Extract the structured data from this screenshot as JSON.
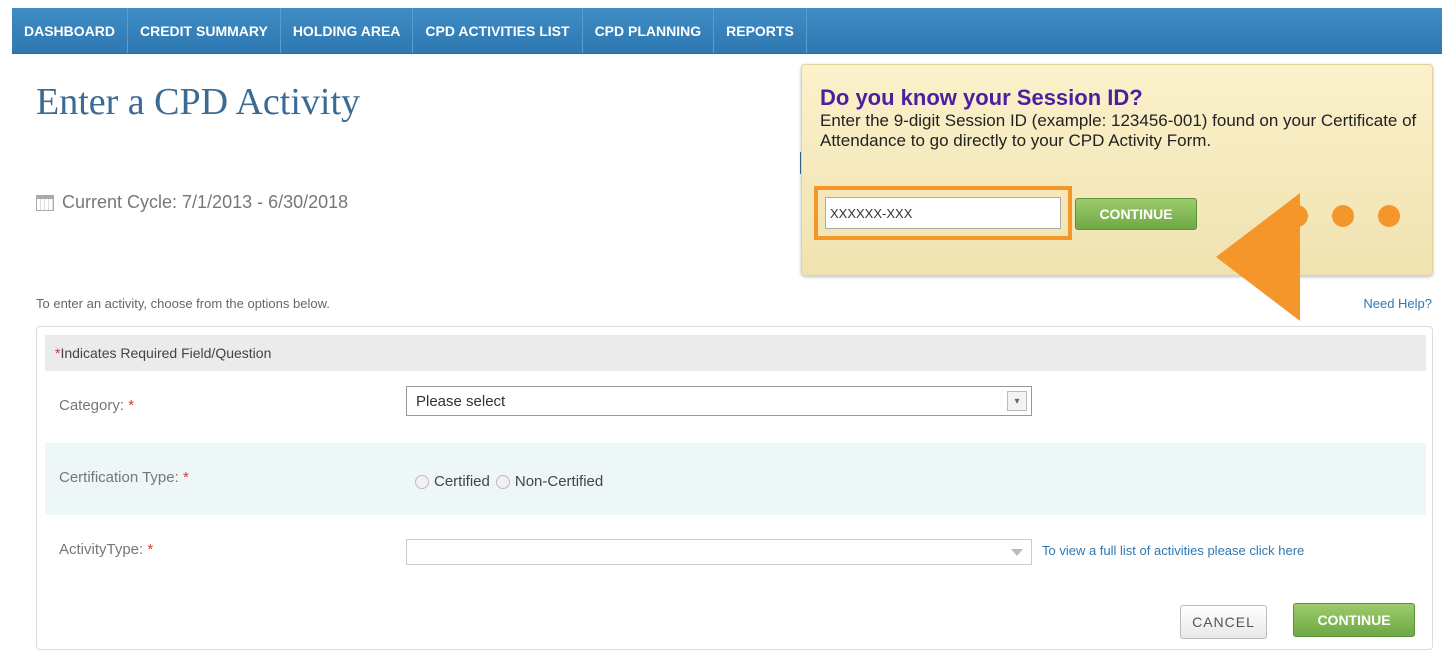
{
  "nav": {
    "items": [
      "DASHBOARD",
      "CREDIT SUMMARY",
      "HOLDING AREA",
      "CPD ACTIVITIES LIST",
      "CPD PLANNING",
      "REPORTS"
    ]
  },
  "page": {
    "title": "Enter a CPD Activity",
    "cycle": "Current Cycle: 7/1/2013 - 6/30/2018"
  },
  "session": {
    "title": "Do you know your Session ID?",
    "description": "Enter the 9-digit Session ID (example: 123456-001) found on your Certificate of Attendance to go directly to your CPD Activity Form.",
    "input_value": "XXXXXX-XXX",
    "continue_label": "CONTINUE"
  },
  "form": {
    "intro": "To enter an activity, choose from the options below.",
    "help": "Need Help?",
    "required_note_star": "*",
    "required_note_text": "Indicates Required Field/Question",
    "category_label": "Category:",
    "category_value": "Please select",
    "cert_label": "Certification Type:",
    "cert_options": [
      "Certified",
      "Non-Certified"
    ],
    "activity_label": "ActivityType:",
    "activity_link": "To view a full list of activities please click here",
    "required_star": "*",
    "cancel_label": "CANCEL",
    "continue_label": "CONTINUE"
  },
  "colors": {
    "nav_bg": "#3282bb",
    "accent_orange": "#f5962a",
    "title_blue": "#3b6a93",
    "session_title": "#4b1fa0",
    "button_green": "#7fb653"
  }
}
